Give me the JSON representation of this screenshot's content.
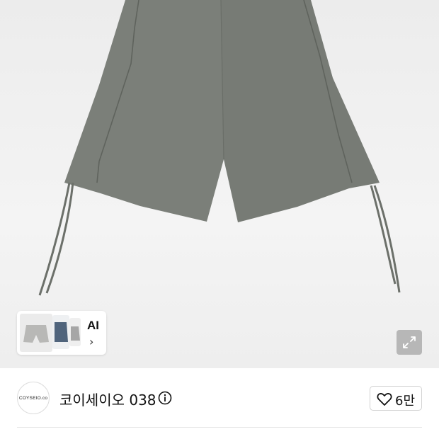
{
  "gallery": {
    "ai_label": "AI",
    "ai_chevron": "›",
    "product_image": "grey-drawstring-shorts",
    "thumbnails": [
      "grey-shorts-thumbnail",
      "navy-shorts-thumbnail",
      "light-grey-shorts-thumbnail"
    ],
    "expand_icon": "expand-icon"
  },
  "seller": {
    "avatar_text": "COYSEIO.co",
    "name": "코이세이오 038",
    "info_icon": "info-icon"
  },
  "like": {
    "icon": "heart-icon",
    "count": "6만"
  },
  "colors": {
    "shorts": "#7b7f79",
    "background": "#eeeeee",
    "expand_button": "#b7b7b7"
  }
}
